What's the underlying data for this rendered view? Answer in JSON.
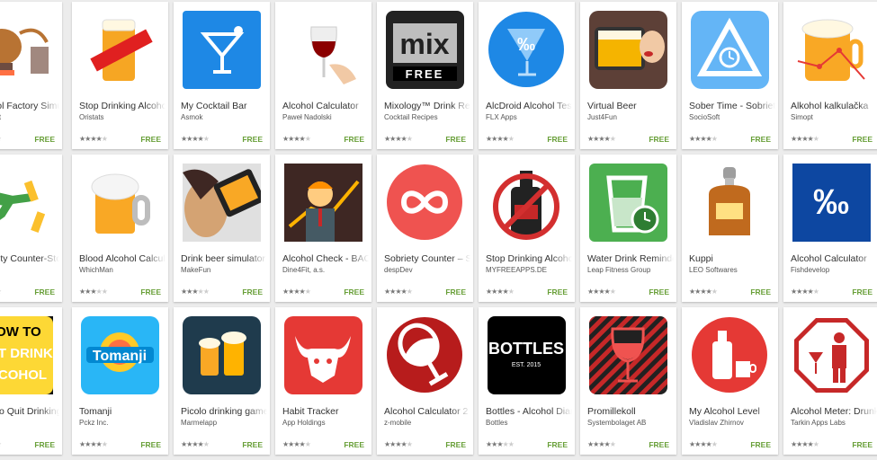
{
  "apps": [
    {
      "title": "Alcohol Factory Simulator",
      "developer": "Playcraft",
      "price": "FREE",
      "rating": 4,
      "icon": "distillery-icon",
      "color": "#b87333"
    },
    {
      "title": "Stop Drinking Alcohol",
      "developer": "Oristats",
      "price": "FREE",
      "rating": 4,
      "icon": "no-beer-icon",
      "color": "#e02020"
    },
    {
      "title": "My Cocktail Bar",
      "developer": "Asmok",
      "price": "FREE",
      "rating": 4.5,
      "icon": "cocktail-glass-icon",
      "color": "#1e88e5"
    },
    {
      "title": "Alcohol Calculator",
      "developer": "Paweł Nadolski",
      "price": "FREE",
      "rating": 4,
      "icon": "wine-glass-icon",
      "color": "#8b0000"
    },
    {
      "title": "Mixology™ Drink Recipes",
      "developer": "Cocktail Recipes",
      "price": "FREE",
      "rating": 4,
      "icon": "mix-free-logo-icon",
      "color": "#222222"
    },
    {
      "title": "AlcDroid Alcohol Tester",
      "developer": "FLX Apps",
      "price": "FREE",
      "rating": 4,
      "icon": "permille-glass-icon",
      "color": "#1e88e5"
    },
    {
      "title": "Virtual Beer",
      "developer": "Just4Fun",
      "price": "FREE",
      "rating": 4,
      "icon": "phone-beer-icon",
      "color": "#f5b400"
    },
    {
      "title": "Sober Time - Sobriety Counter",
      "developer": "SocioSoft",
      "price": "FREE",
      "rating": 4.5,
      "icon": "sober-triangle-icon",
      "color": "#64b5f6"
    },
    {
      "title": "Alkohol kalkulačka",
      "developer": "Simopt",
      "price": "FREE",
      "rating": 4,
      "icon": "beer-chart-icon",
      "color": "#f9a825"
    },
    {
      "title": "Sobriety Counter-Stop Drinking",
      "developer": "Hanna",
      "price": "FREE",
      "rating": 4,
      "icon": "kick-bottles-icon",
      "color": "#43a047"
    },
    {
      "title": "Blood Alcohol Calculator",
      "developer": "WhichMan",
      "price": "FREE",
      "rating": 3.5,
      "icon": "beer-mug-icon",
      "color": "#f9a825"
    },
    {
      "title": "Drink beer simulator",
      "developer": "MakeFun",
      "price": "FREE",
      "rating": 3.5,
      "icon": "drinking-woman-icon",
      "color": "#d4a373"
    },
    {
      "title": "Alcohol Check - BAC Calculator",
      "developer": "Dine4Fit, a.s.",
      "price": "FREE",
      "rating": 4,
      "icon": "businessman-cartoon-icon",
      "color": "#8d6e63"
    },
    {
      "title": "Sobriety Counter – Stop Drinking",
      "developer": "despDev",
      "price": "FREE",
      "rating": 4.5,
      "icon": "infinity-circle-icon",
      "color": "#ef5350"
    },
    {
      "title": "Stop Drinking Alcohol",
      "developer": "MYFREEAPPS.DE",
      "price": "FREE",
      "rating": 4,
      "icon": "no-bottle-icon",
      "color": "#d32f2f"
    },
    {
      "title": "Water Drink Reminder",
      "developer": "Leap Fitness Group",
      "price": "FREE",
      "rating": 4.5,
      "icon": "water-glass-clock-icon",
      "color": "#4caf50"
    },
    {
      "title": "Kuppi",
      "developer": "LEO Softwares",
      "price": "FREE",
      "rating": 4,
      "icon": "whisky-decanter-icon",
      "color": "#c06a1e"
    },
    {
      "title": "Alcohol Calculator",
      "developer": "Fishdevelop",
      "price": "FREE",
      "rating": 4,
      "icon": "permille-sign-icon",
      "color": "#0d47a1"
    },
    {
      "title": "How To Quit Drinking Alcohol",
      "developer": "APPS",
      "price": "FREE",
      "rating": 4,
      "icon": "quit-drink-text-icon",
      "color": "#fdd835",
      "lines": [
        "HOW TO",
        "QUIT DRINK",
        "ALCOHOL"
      ]
    },
    {
      "title": "Tomanji",
      "developer": "Pckz Inc.",
      "price": "FREE",
      "rating": 4.5,
      "icon": "tomanji-logo-icon",
      "color": "#29b6f6",
      "logo": "Tomanji"
    },
    {
      "title": "Picolo drinking game",
      "developer": "Marmelapp",
      "price": "FREE",
      "rating": 4.5,
      "icon": "beer-glasses-icon",
      "color": "#1f3b4d"
    },
    {
      "title": "Habit Tracker",
      "developer": "App Holdings",
      "price": "FREE",
      "rating": 4.5,
      "icon": "bull-head-icon",
      "color": "#e53935"
    },
    {
      "title": "Alcohol Calculator 2",
      "developer": "z-mobile",
      "price": "FREE",
      "rating": 4,
      "icon": "tilted-wine-glass-icon",
      "color": "#b71c1c"
    },
    {
      "title": "Bottles - Alcohol Diary",
      "developer": "Bottles",
      "price": "FREE",
      "rating": 3.5,
      "icon": "bottles-logo-icon",
      "color": "#000000",
      "logo": "BOTTLES",
      "logo_sub": "EST. 2015"
    },
    {
      "title": "Promillekoll",
      "developer": "Systembolaget AB",
      "price": "FREE",
      "rating": 4.5,
      "icon": "striped-wine-glass-icon",
      "color": "#c62828"
    },
    {
      "title": "My Alcohol Level",
      "developer": "Vladislav Zhirnov",
      "price": "FREE",
      "rating": 4.5,
      "icon": "bottle-cup-icon",
      "color": "#e53935"
    },
    {
      "title": "Alcohol Meter: Drunk Test",
      "developer": "Tarkin Apps Labs",
      "price": "FREE",
      "rating": 4.5,
      "icon": "stop-sign-man-icon",
      "color": "#c62828"
    }
  ]
}
